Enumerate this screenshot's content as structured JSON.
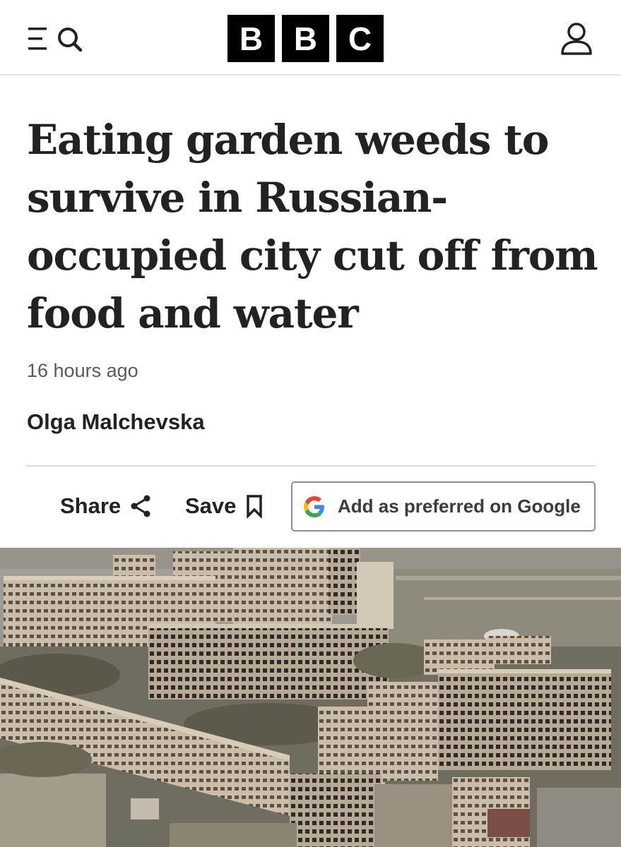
{
  "header": {
    "logo_letters": [
      "B",
      "B",
      "C"
    ],
    "icons": {
      "menu": "menu-icon",
      "search": "search-icon",
      "account": "account-icon"
    }
  },
  "article": {
    "headline": "Eating garden weeds to survive in Russian-occupied city cut off from food and water",
    "timestamp": "16 hours ago",
    "author": "Olga Malchevska"
  },
  "actions": {
    "share_label": "Share",
    "save_label": "Save",
    "google_label": "Add as preferred on Google",
    "icons": {
      "share": "share-icon",
      "save": "bookmark-icon",
      "google": "google-g-icon"
    }
  },
  "hero_image": {
    "subject": "aerial-view-of-damaged-apartment-blocks"
  },
  "colors": {
    "text": "#202224",
    "muted": "#5a5a5a",
    "logo_bg": "#000000",
    "divider": "#dcdcdc"
  }
}
